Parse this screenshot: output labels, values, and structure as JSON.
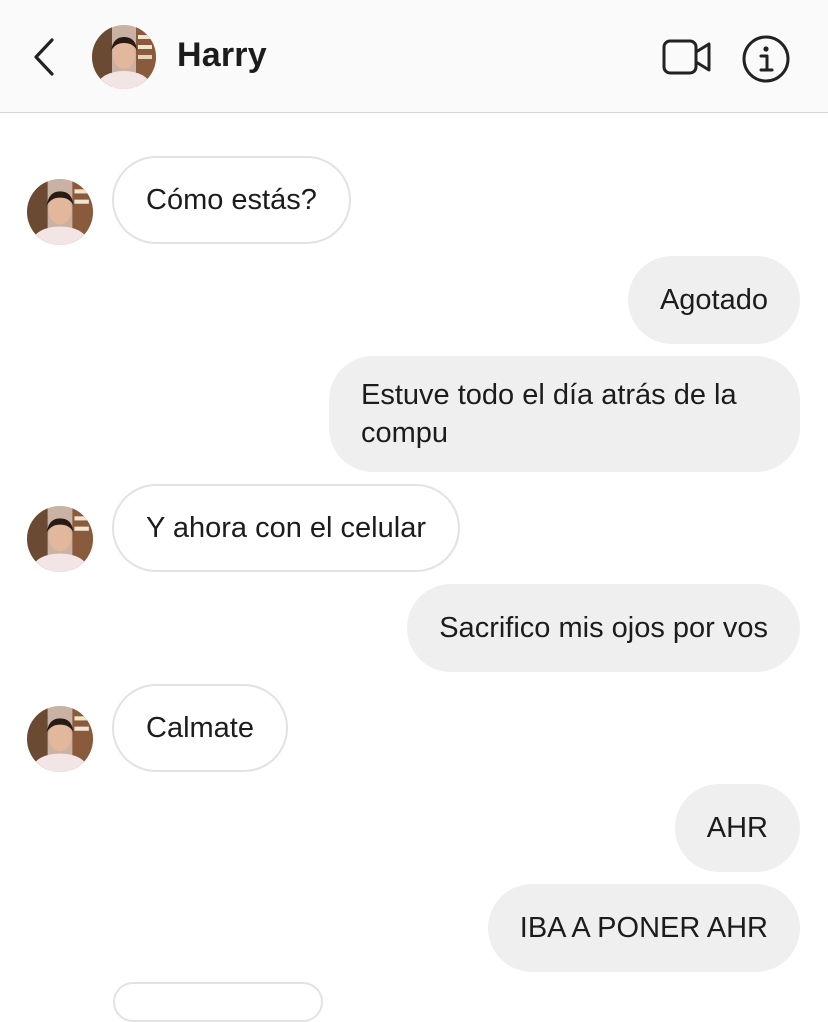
{
  "header": {
    "contact_name": "Harry",
    "back_icon": "chevron-left-icon",
    "video_icon": "video-camera-icon",
    "info_icon": "info-icon"
  },
  "messages": [
    {
      "from": "contact",
      "text": "Cómo estás?"
    },
    {
      "from": "me",
      "text": "Agotado"
    },
    {
      "from": "me",
      "text": "Estuve todo el día atrás de la compu"
    },
    {
      "from": "contact",
      "text": "Y ahora con el celular"
    },
    {
      "from": "me",
      "text": "Sacrifico mis ojos por vos"
    },
    {
      "from": "contact",
      "text": "Calmate"
    },
    {
      "from": "me",
      "text": "AHR"
    },
    {
      "from": "me",
      "text": "IBA A PONER AHR"
    }
  ],
  "colors": {
    "header_bg": "#fafafa",
    "outgoing_bubble": "#efefef",
    "incoming_border": "#e2e2e2",
    "text": "#1c1c1c"
  }
}
